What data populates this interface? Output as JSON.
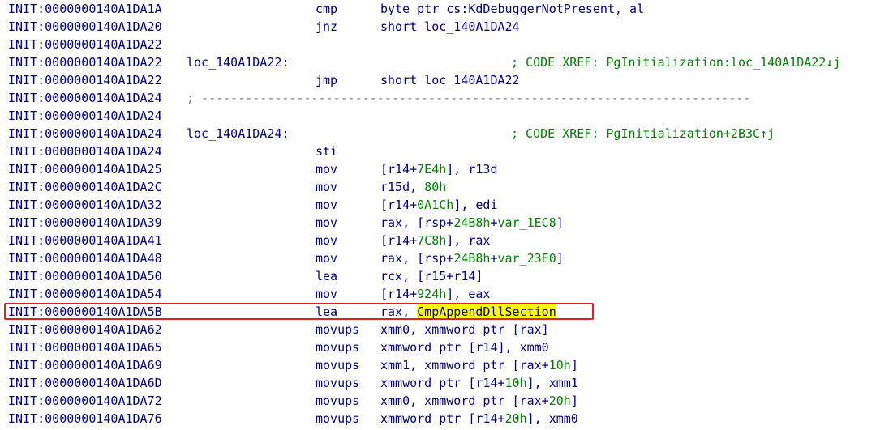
{
  "colors": {
    "default_text": "#000080",
    "comment_text": "#008000",
    "number_text": "#008000",
    "separator_text": "#808080",
    "highlight_bg": "#ffff00",
    "selection_border": "#e02020"
  },
  "lines": [
    {
      "addr": "INIT:0000000140A1DA1A",
      "mnemonic": "cmp",
      "operands": [
        {
          "t": "byte ptr cs:KdDebuggerNotPresent, al"
        }
      ]
    },
    {
      "addr": "INIT:0000000140A1DA20",
      "mnemonic": "jnz",
      "operands": [
        {
          "t": "short loc_140A1DA24"
        }
      ]
    },
    {
      "addr": "INIT:0000000140A1DA22"
    },
    {
      "addr": "INIT:0000000140A1DA22",
      "label": "loc_140A1DA22:",
      "comment": "; CODE XREF: PgInitialization:loc_140A1DA22↓j"
    },
    {
      "addr": "INIT:0000000140A1DA22",
      "mnemonic": "jmp",
      "operands": [
        {
          "t": "short loc_140A1DA22"
        }
      ]
    },
    {
      "addr": "INIT:0000000140A1DA24",
      "separator": "; ---------------------------------------------------------------------------"
    },
    {
      "addr": "INIT:0000000140A1DA24"
    },
    {
      "addr": "INIT:0000000140A1DA24",
      "label": "loc_140A1DA24:",
      "comment": "; CODE XREF: PgInitialization+2B3C↑j"
    },
    {
      "addr": "INIT:0000000140A1DA24",
      "mnemonic": "sti"
    },
    {
      "addr": "INIT:0000000140A1DA25",
      "mnemonic": "mov",
      "operands": [
        {
          "t": "[r14+"
        },
        {
          "t": "7E4h",
          "c": "num"
        },
        {
          "t": "], r13d"
        }
      ]
    },
    {
      "addr": "INIT:0000000140A1DA2C",
      "mnemonic": "mov",
      "operands": [
        {
          "t": "r15d, "
        },
        {
          "t": "80h",
          "c": "num"
        }
      ]
    },
    {
      "addr": "INIT:0000000140A1DA32",
      "mnemonic": "mov",
      "operands": [
        {
          "t": "[r14+"
        },
        {
          "t": "0A1Ch",
          "c": "num"
        },
        {
          "t": "], edi"
        }
      ]
    },
    {
      "addr": "INIT:0000000140A1DA39",
      "mnemonic": "mov",
      "operands": [
        {
          "t": "rax, [rsp+"
        },
        {
          "t": "24B8h",
          "c": "num"
        },
        {
          "t": "+"
        },
        {
          "t": "var_1EC8",
          "c": "num"
        },
        {
          "t": "]"
        }
      ]
    },
    {
      "addr": "INIT:0000000140A1DA41",
      "mnemonic": "mov",
      "operands": [
        {
          "t": "[r14+"
        },
        {
          "t": "7C8h",
          "c": "num"
        },
        {
          "t": "], rax"
        }
      ]
    },
    {
      "addr": "INIT:0000000140A1DA48",
      "mnemonic": "mov",
      "operands": [
        {
          "t": "rax, [rsp+"
        },
        {
          "t": "24B8h",
          "c": "num"
        },
        {
          "t": "+"
        },
        {
          "t": "var_23E0",
          "c": "num"
        },
        {
          "t": "]"
        }
      ]
    },
    {
      "addr": "INIT:0000000140A1DA50",
      "mnemonic": "lea",
      "operands": [
        {
          "t": "rcx, [r15+r14]"
        }
      ]
    },
    {
      "addr": "INIT:0000000140A1DA54",
      "mnemonic": "mov",
      "operands": [
        {
          "t": "[r14+"
        },
        {
          "t": "924h",
          "c": "num"
        },
        {
          "t": "], eax"
        }
      ]
    },
    {
      "addr": "INIT:0000000140A1DA5B",
      "mnemonic": "lea",
      "selected": true,
      "operands": [
        {
          "t": "rax, "
        },
        {
          "t": "CmpAppendDllSection",
          "c": "hl"
        }
      ]
    },
    {
      "addr": "INIT:0000000140A1DA62",
      "mnemonic": "movups",
      "operands": [
        {
          "t": "xmm0, xmmword ptr [rax]"
        }
      ]
    },
    {
      "addr": "INIT:0000000140A1DA65",
      "mnemonic": "movups",
      "operands": [
        {
          "t": "xmmword ptr [r14], xmm0"
        }
      ]
    },
    {
      "addr": "INIT:0000000140A1DA69",
      "mnemonic": "movups",
      "operands": [
        {
          "t": "xmm1, xmmword ptr [rax+"
        },
        {
          "t": "10h",
          "c": "num"
        },
        {
          "t": "]"
        }
      ]
    },
    {
      "addr": "INIT:0000000140A1DA6D",
      "mnemonic": "movups",
      "operands": [
        {
          "t": "xmmword ptr [r14+"
        },
        {
          "t": "10h",
          "c": "num"
        },
        {
          "t": "], xmm1"
        }
      ]
    },
    {
      "addr": "INIT:0000000140A1DA72",
      "mnemonic": "movups",
      "operands": [
        {
          "t": "xmm0, xmmword ptr [rax+"
        },
        {
          "t": "20h",
          "c": "num"
        },
        {
          "t": "]"
        }
      ]
    },
    {
      "addr": "INIT:0000000140A1DA76",
      "mnemonic": "movups",
      "operands": [
        {
          "t": "xmmword ptr [r14+"
        },
        {
          "t": "20h",
          "c": "num"
        },
        {
          "t": "], xmm0"
        }
      ]
    }
  ]
}
